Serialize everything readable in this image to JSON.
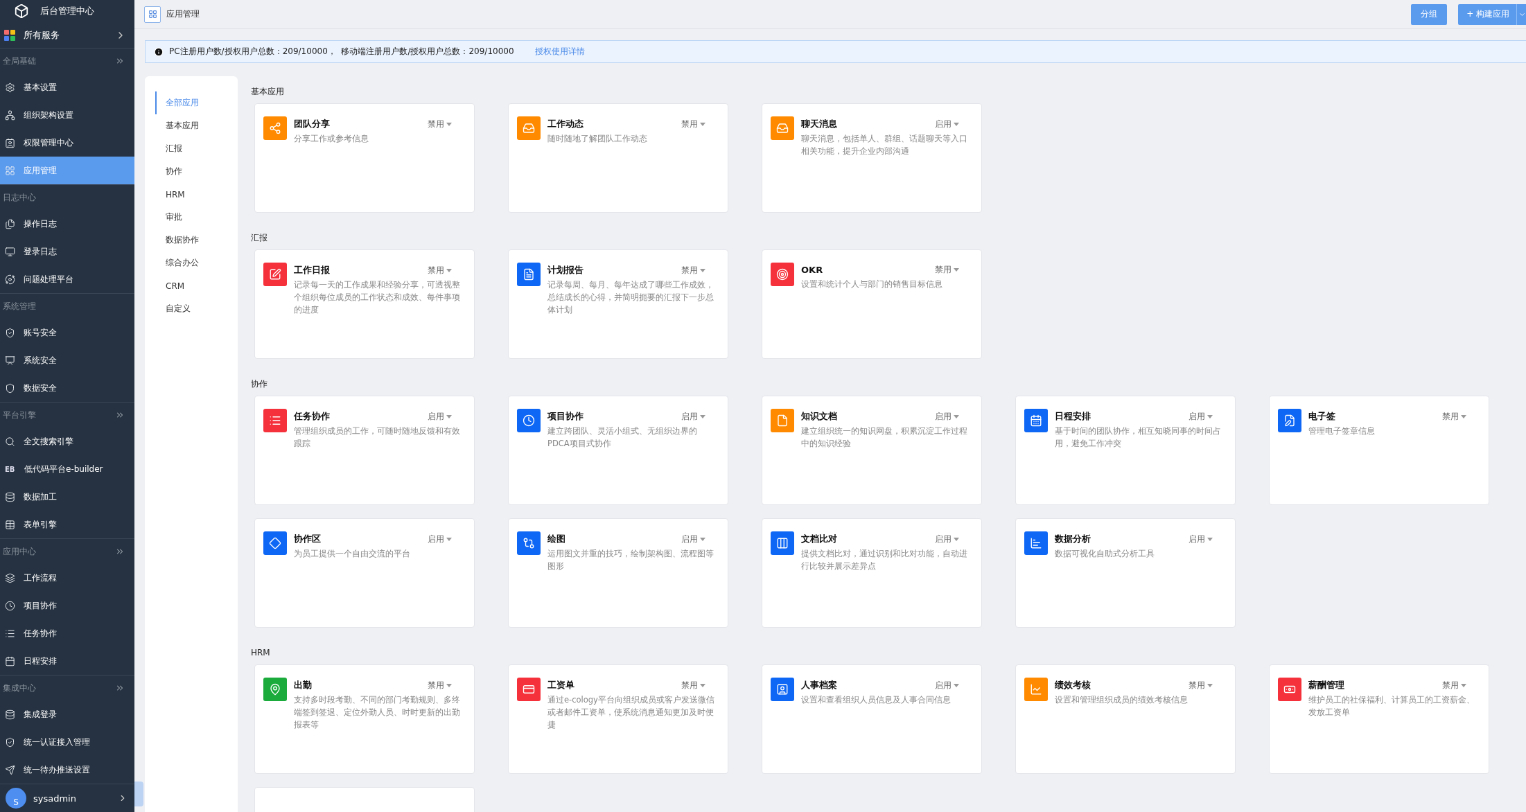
{
  "sidebar": {
    "title": "后台管理中心",
    "all_services": "所有服务",
    "sections": [
      {
        "title": "全局基础",
        "collapsible": true,
        "items": [
          {
            "label": "基本设置",
            "selected": false
          },
          {
            "label": "组织架构设置",
            "selected": false
          },
          {
            "label": "权限管理中心",
            "selected": false
          },
          {
            "label": "应用管理",
            "selected": true
          }
        ]
      },
      {
        "title": "日志中心",
        "collapsible": false,
        "items": [
          {
            "label": "操作日志",
            "selected": false
          },
          {
            "label": "登录日志",
            "selected": false
          },
          {
            "label": "问题处理平台",
            "selected": false
          }
        ]
      },
      {
        "title": "系统管理",
        "collapsible": false,
        "items": [
          {
            "label": "账号安全",
            "selected": false
          },
          {
            "label": "系统安全",
            "selected": false
          },
          {
            "label": "数据安全",
            "selected": false
          }
        ]
      },
      {
        "title": "平台引擎",
        "collapsible": true,
        "items": [
          {
            "label": "全文搜索引擎",
            "selected": false
          },
          {
            "label": "低代码平台e-builder",
            "badge": "EB",
            "selected": false
          },
          {
            "label": "数据加工",
            "selected": false
          },
          {
            "label": "表单引擎",
            "selected": false
          }
        ]
      },
      {
        "title": "应用中心",
        "collapsible": true,
        "items": [
          {
            "label": "工作流程",
            "selected": false
          },
          {
            "label": "项目协作",
            "selected": false
          },
          {
            "label": "任务协作",
            "selected": false
          },
          {
            "label": "日程安排",
            "selected": false
          }
        ]
      },
      {
        "title": "集成中心",
        "collapsible": true,
        "items": [
          {
            "label": "集成登录",
            "selected": false
          },
          {
            "label": "统一认证接入管理",
            "selected": false
          },
          {
            "label": "统一待办推送设置",
            "selected": false
          }
        ]
      }
    ],
    "user": {
      "avatar": "S",
      "name": "sysadmin"
    }
  },
  "header": {
    "title": "应用管理",
    "buttons": [
      {
        "label": "分组",
        "kind": "plain"
      },
      {
        "label": "+ 构建应用",
        "kind": "split"
      }
    ]
  },
  "notice": {
    "text": "PC注册用户数/授权用户总数：209/10000，  移动端注册用户数/授权用户总数：209/10000",
    "link": "授权使用详情"
  },
  "categories": [
    {
      "label": "全部应用",
      "selected": true
    },
    {
      "label": "基本应用",
      "selected": false
    },
    {
      "label": "汇报",
      "selected": false
    },
    {
      "label": "协作",
      "selected": false
    },
    {
      "label": "HRM",
      "selected": false
    },
    {
      "label": "审批",
      "selected": false
    },
    {
      "label": "数据协作",
      "selected": false
    },
    {
      "label": "综合办公",
      "selected": false
    },
    {
      "label": "CRM",
      "selected": false
    },
    {
      "label": "自定义",
      "selected": false
    }
  ],
  "sections": [
    {
      "title": "基本应用",
      "apps": [
        {
          "kind": "app",
          "name": "团队分享",
          "status": "禁用",
          "color": "#ff8a00",
          "description": "分享工作或参考信息"
        },
        {
          "kind": "app",
          "name": "工作动态",
          "status": "禁用",
          "color": "#ff8a00",
          "description": "随时随地了解团队工作动态"
        },
        {
          "kind": "app",
          "name": "聊天消息",
          "status": "启用",
          "color": "#ff8a00",
          "description": "聊天消息，包括单人、群组、话题聊天等入口相关功能，提升企业内部沟通"
        }
      ]
    },
    {
      "title": "汇报",
      "apps": [
        {
          "kind": "app",
          "name": "工作日报",
          "status": "禁用",
          "color": "#f5323c",
          "description": "记录每一天的工作成果和经验分享，可透视整个组织每位成员的工作状态和成效、每件事项的进度"
        },
        {
          "kind": "app",
          "name": "计划报告",
          "status": "禁用",
          "color": "#0f67f5",
          "description": "记录每周、每月、每年达成了哪些工作成效，总结成长的心得，并简明扼要的汇报下一步总体计划"
        },
        {
          "kind": "app",
          "name": "OKR",
          "status": "禁用",
          "color": "#f5323c",
          "description": "设置和统计个人与部门的销售目标信息"
        }
      ]
    },
    {
      "title": "协作",
      "apps": [
        {
          "kind": "app",
          "name": "任务协作",
          "status": "启用",
          "color": "#f5323c",
          "description": "管理组织成员的工作，可随时随地反馈和有效跟踪"
        },
        {
          "kind": "app",
          "name": "项目协作",
          "status": "启用",
          "color": "#0f67f5",
          "description": "建立跨团队、灵活小组式、无组织边界的PDCA项目式协作"
        },
        {
          "kind": "app",
          "name": "知识文档",
          "status": "启用",
          "color": "#ff8a00",
          "description": "建立组织统一的知识网盘，积累沉淀工作过程中的知识经验"
        },
        {
          "kind": "app",
          "name": "日程安排",
          "status": "启用",
          "color": "#0f67f5",
          "description": "基于时间的团队协作，相互知晓同事的时间占用，避免工作冲突"
        },
        {
          "kind": "app",
          "name": "电子签",
          "status": "禁用",
          "color": "#0f67f5",
          "description": "管理电子签章信息"
        },
        {
          "kind": "app",
          "name": "协作区",
          "status": "启用",
          "color": "#0f67f5",
          "description": "为员工提供一个自由交流的平台"
        },
        {
          "kind": "app",
          "name": "绘图",
          "status": "启用",
          "color": "#0f67f5",
          "description": "运用图文并重的技巧，绘制架构图、流程图等图形"
        },
        {
          "kind": "app",
          "name": "文档比对",
          "status": "启用",
          "color": "#0f67f5",
          "description": "提供文档比对，通过识别和比对功能，自动进行比较并展示差异点"
        },
        {
          "kind": "app",
          "name": "数据分析",
          "status": "启用",
          "color": "#0f67f5",
          "description": "数据可视化自助式分析工具"
        }
      ]
    },
    {
      "title": "HRM",
      "apps": [
        {
          "kind": "app",
          "name": "出勤",
          "status": "禁用",
          "color": "#1aab3c",
          "description": "支持多时段考勤、不同的部门考勤规则、多终端签到签退、定位外勤人员、时时更新的出勤报表等"
        },
        {
          "kind": "app",
          "name": "工资单",
          "status": "禁用",
          "color": "#f5323c",
          "description": "通过e-cology平台向组织成员或客户发送微信或者邮件工资单，使系统消息通知更加及时便捷"
        },
        {
          "kind": "app",
          "name": "人事档案",
          "status": "启用",
          "color": "#0f67f5",
          "description": "设置和查看组织人员信息及人事合同信息"
        },
        {
          "kind": "app",
          "name": "绩效考核",
          "status": "禁用",
          "color": "#ff8a00",
          "description": "设置和管理组织成员的绩效考核信息"
        },
        {
          "kind": "app",
          "name": "薪酬管理",
          "status": "禁用",
          "color": "#f5323c",
          "description": "维护员工的社保福利、计算员工的工资薪金、发放工资单"
        },
        {
          "kind": "cut"
        }
      ]
    }
  ]
}
